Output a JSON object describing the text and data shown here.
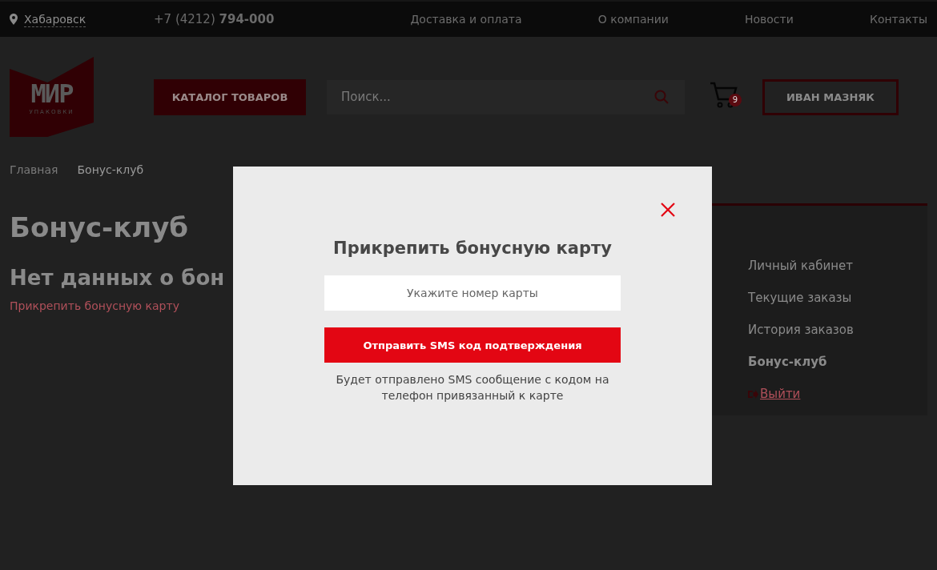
{
  "topbar": {
    "city": "Хабаровск",
    "phone_prefix": "+7 (4212)",
    "phone_number": "794-000",
    "nav": [
      "Доставка и оплата",
      "О компании",
      "Новости",
      "Контакты"
    ]
  },
  "header": {
    "logo": {
      "title": "МИР",
      "subtitle": "УПАКОВКИ"
    },
    "catalog_button": "КАТАЛОГ ТОВАРОВ",
    "search": {
      "placeholder": "Поиск..."
    },
    "cart_count": "9",
    "user_button": "ИВАН МАЗНЯК"
  },
  "breadcrumbs": [
    "Главная",
    "Бонус-клуб"
  ],
  "page_title": "Бонус-клуб",
  "subtitle": "Нет данных о бон",
  "attach_link": "Прикрепить бонусную карту",
  "sidebar": [
    {
      "kind": "link",
      "label": "Личный кабинет",
      "selected": false
    },
    {
      "kind": "link",
      "label": "Текущие заказы",
      "selected": false
    },
    {
      "kind": "link",
      "label": "История заказов",
      "selected": false
    },
    {
      "kind": "link",
      "label": "Бонус-клуб",
      "selected": true
    },
    {
      "kind": "logout",
      "label": "Выйти",
      "selected": false
    }
  ],
  "modal": {
    "title": "Прикрепить бонусную карту",
    "card_field": {
      "placeholder": "Укажите номер карты"
    },
    "submit_button": "Отправить SMS код подтверждения",
    "note": "Будет отправлено SMS сообщение с кодом на телефон привязанный к карте"
  }
}
